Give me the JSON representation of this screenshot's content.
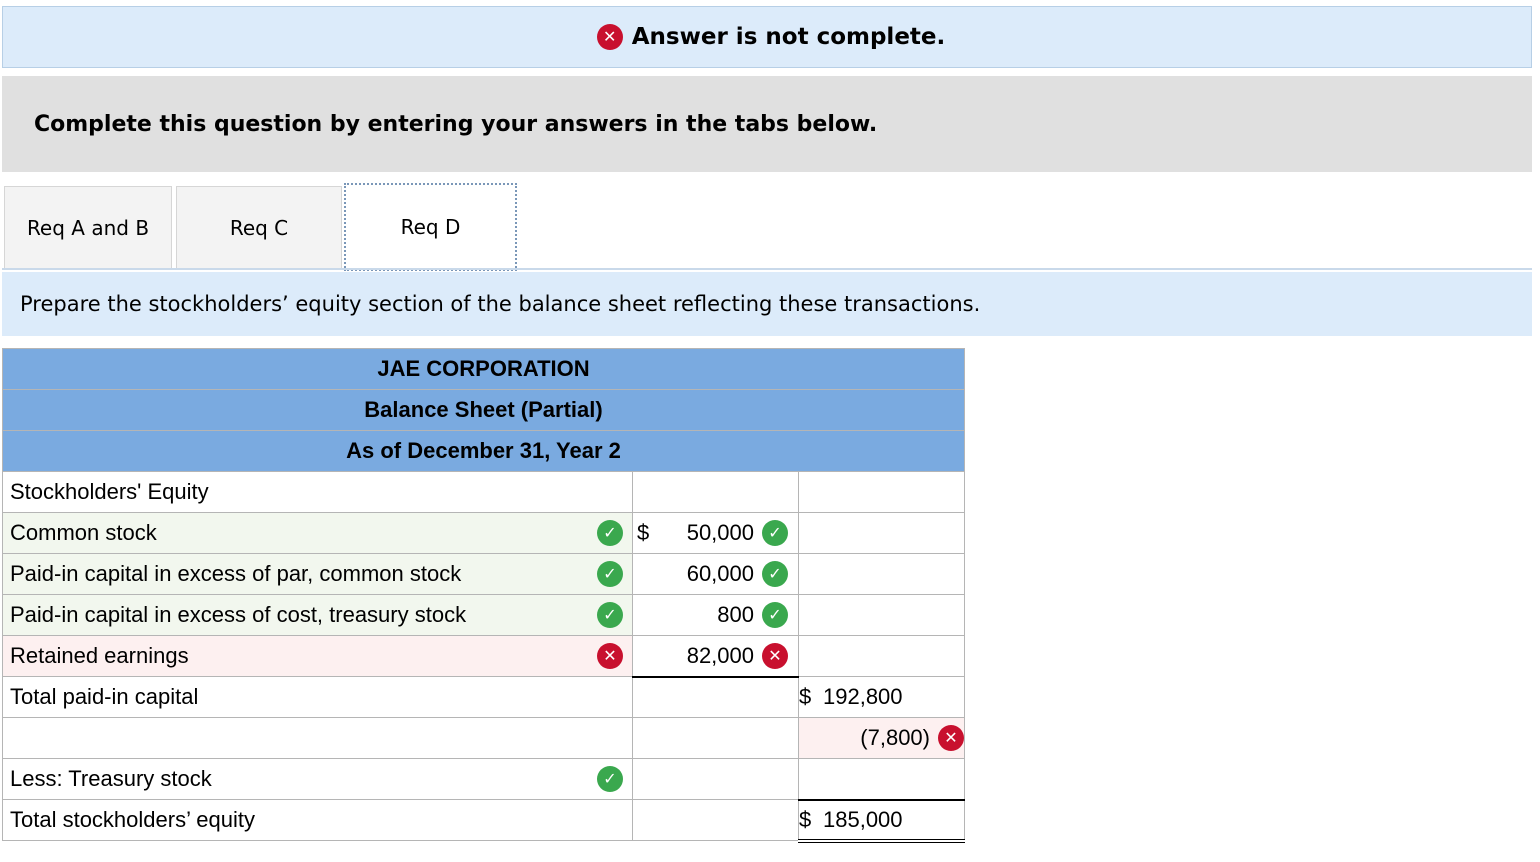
{
  "banner": {
    "text": "Answer is not complete.",
    "icon": "x-circle-icon",
    "icon_color": "#c8102e"
  },
  "instructions": "Complete this question by entering your answers in the tabs below.",
  "tabs": [
    {
      "label": "Req A and B",
      "active": false
    },
    {
      "label": "Req C",
      "active": false
    },
    {
      "label": "Req D",
      "active": true
    }
  ],
  "prompt": "Prepare the stockholders’ equity section of the balance sheet reflecting these transactions.",
  "statement": {
    "company": "JAE CORPORATION",
    "title": "Balance Sheet (Partial)",
    "date": "As of December 31, Year 2",
    "section_label": "Stockholders' Equity",
    "rows": [
      {
        "label": "Common stock",
        "label_status": "correct",
        "currency": "$",
        "amount": "50,000",
        "amount_status": "correct",
        "total": ""
      },
      {
        "label": "Paid-in capital in excess of par, common stock",
        "label_status": "correct",
        "currency": "",
        "amount": "60,000",
        "amount_status": "correct",
        "total": ""
      },
      {
        "label": "Paid-in capital in excess of cost, treasury stock",
        "label_status": "correct",
        "currency": "",
        "amount": "800",
        "amount_status": "correct",
        "total": ""
      },
      {
        "label": "Retained earnings",
        "label_status": "incorrect",
        "currency": "",
        "amount": "82,000",
        "amount_status": "incorrect",
        "total": ""
      }
    ],
    "total_paid_in": {
      "label": "Total paid-in capital",
      "currency": "$",
      "amount": "192,800"
    },
    "blank_row": {
      "label": "",
      "amount": "(7,800)",
      "status": "incorrect"
    },
    "treasury": {
      "label": "Less: Treasury stock",
      "status": "correct"
    },
    "total_equity": {
      "label": "Total stockholders’ equity",
      "currency": "$",
      "amount": "185,000"
    }
  },
  "colors": {
    "correct": "#3aa84e",
    "incorrect": "#c8102e",
    "header_bg": "#7aaae0",
    "banner_bg": "#dcebfa"
  }
}
